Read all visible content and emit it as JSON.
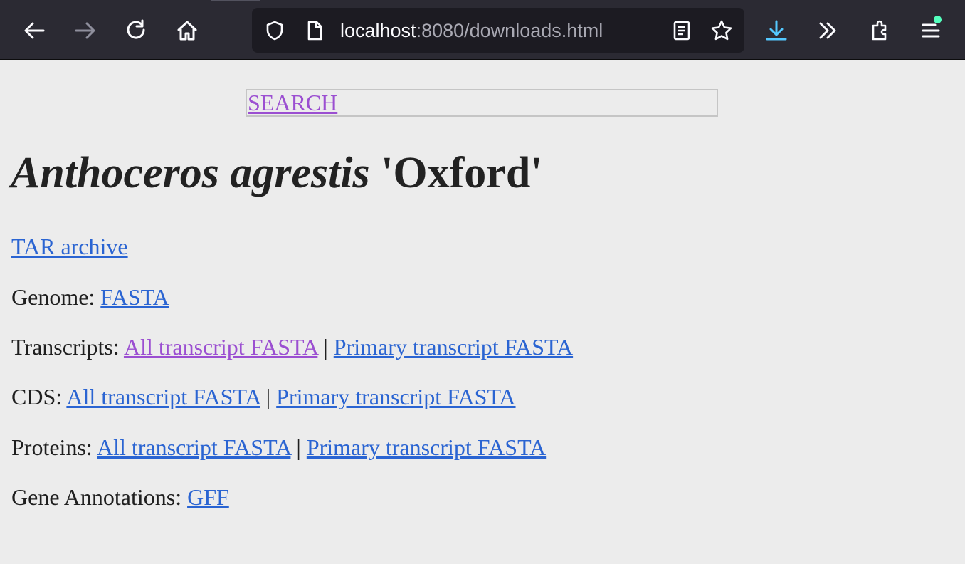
{
  "browser": {
    "url_host": "localhost",
    "url_rest": ":8080/downloads.html",
    "accent_color": "#2b2a33",
    "icons": [
      "back-icon",
      "forward-icon",
      "reload-icon",
      "home-icon",
      "shield-icon",
      "page-icon",
      "reader-view-icon",
      "bookmark-star-icon",
      "download-icon",
      "overflow-chevrons-icon",
      "extensions-icon",
      "menu-icon"
    ]
  },
  "page": {
    "search_label": "SEARCH",
    "title_italic": "Anthoceros agrestis",
    "title_rest": " 'Oxford'",
    "tar_archive": "TAR archive",
    "genome": {
      "label": "Genome: ",
      "fasta": "FASTA"
    },
    "transcripts": {
      "label": "Transcripts: ",
      "all": "All transcript FASTA",
      "sep": " | ",
      "primary": "Primary transcript FASTA"
    },
    "cds": {
      "label": "CDS: ",
      "all": "All transcript FASTA",
      "sep": " | ",
      "primary": "Primary transcript FASTA"
    },
    "proteins": {
      "label": "Proteins: ",
      "all": "All transcript FASTA",
      "sep": " | ",
      "primary": "Primary transcript FASTA"
    },
    "annotations": {
      "label": "Gene Annotations: ",
      "gff": "GFF"
    },
    "link_color": "#2a64d2",
    "visited_color": "#9b4fd1"
  }
}
